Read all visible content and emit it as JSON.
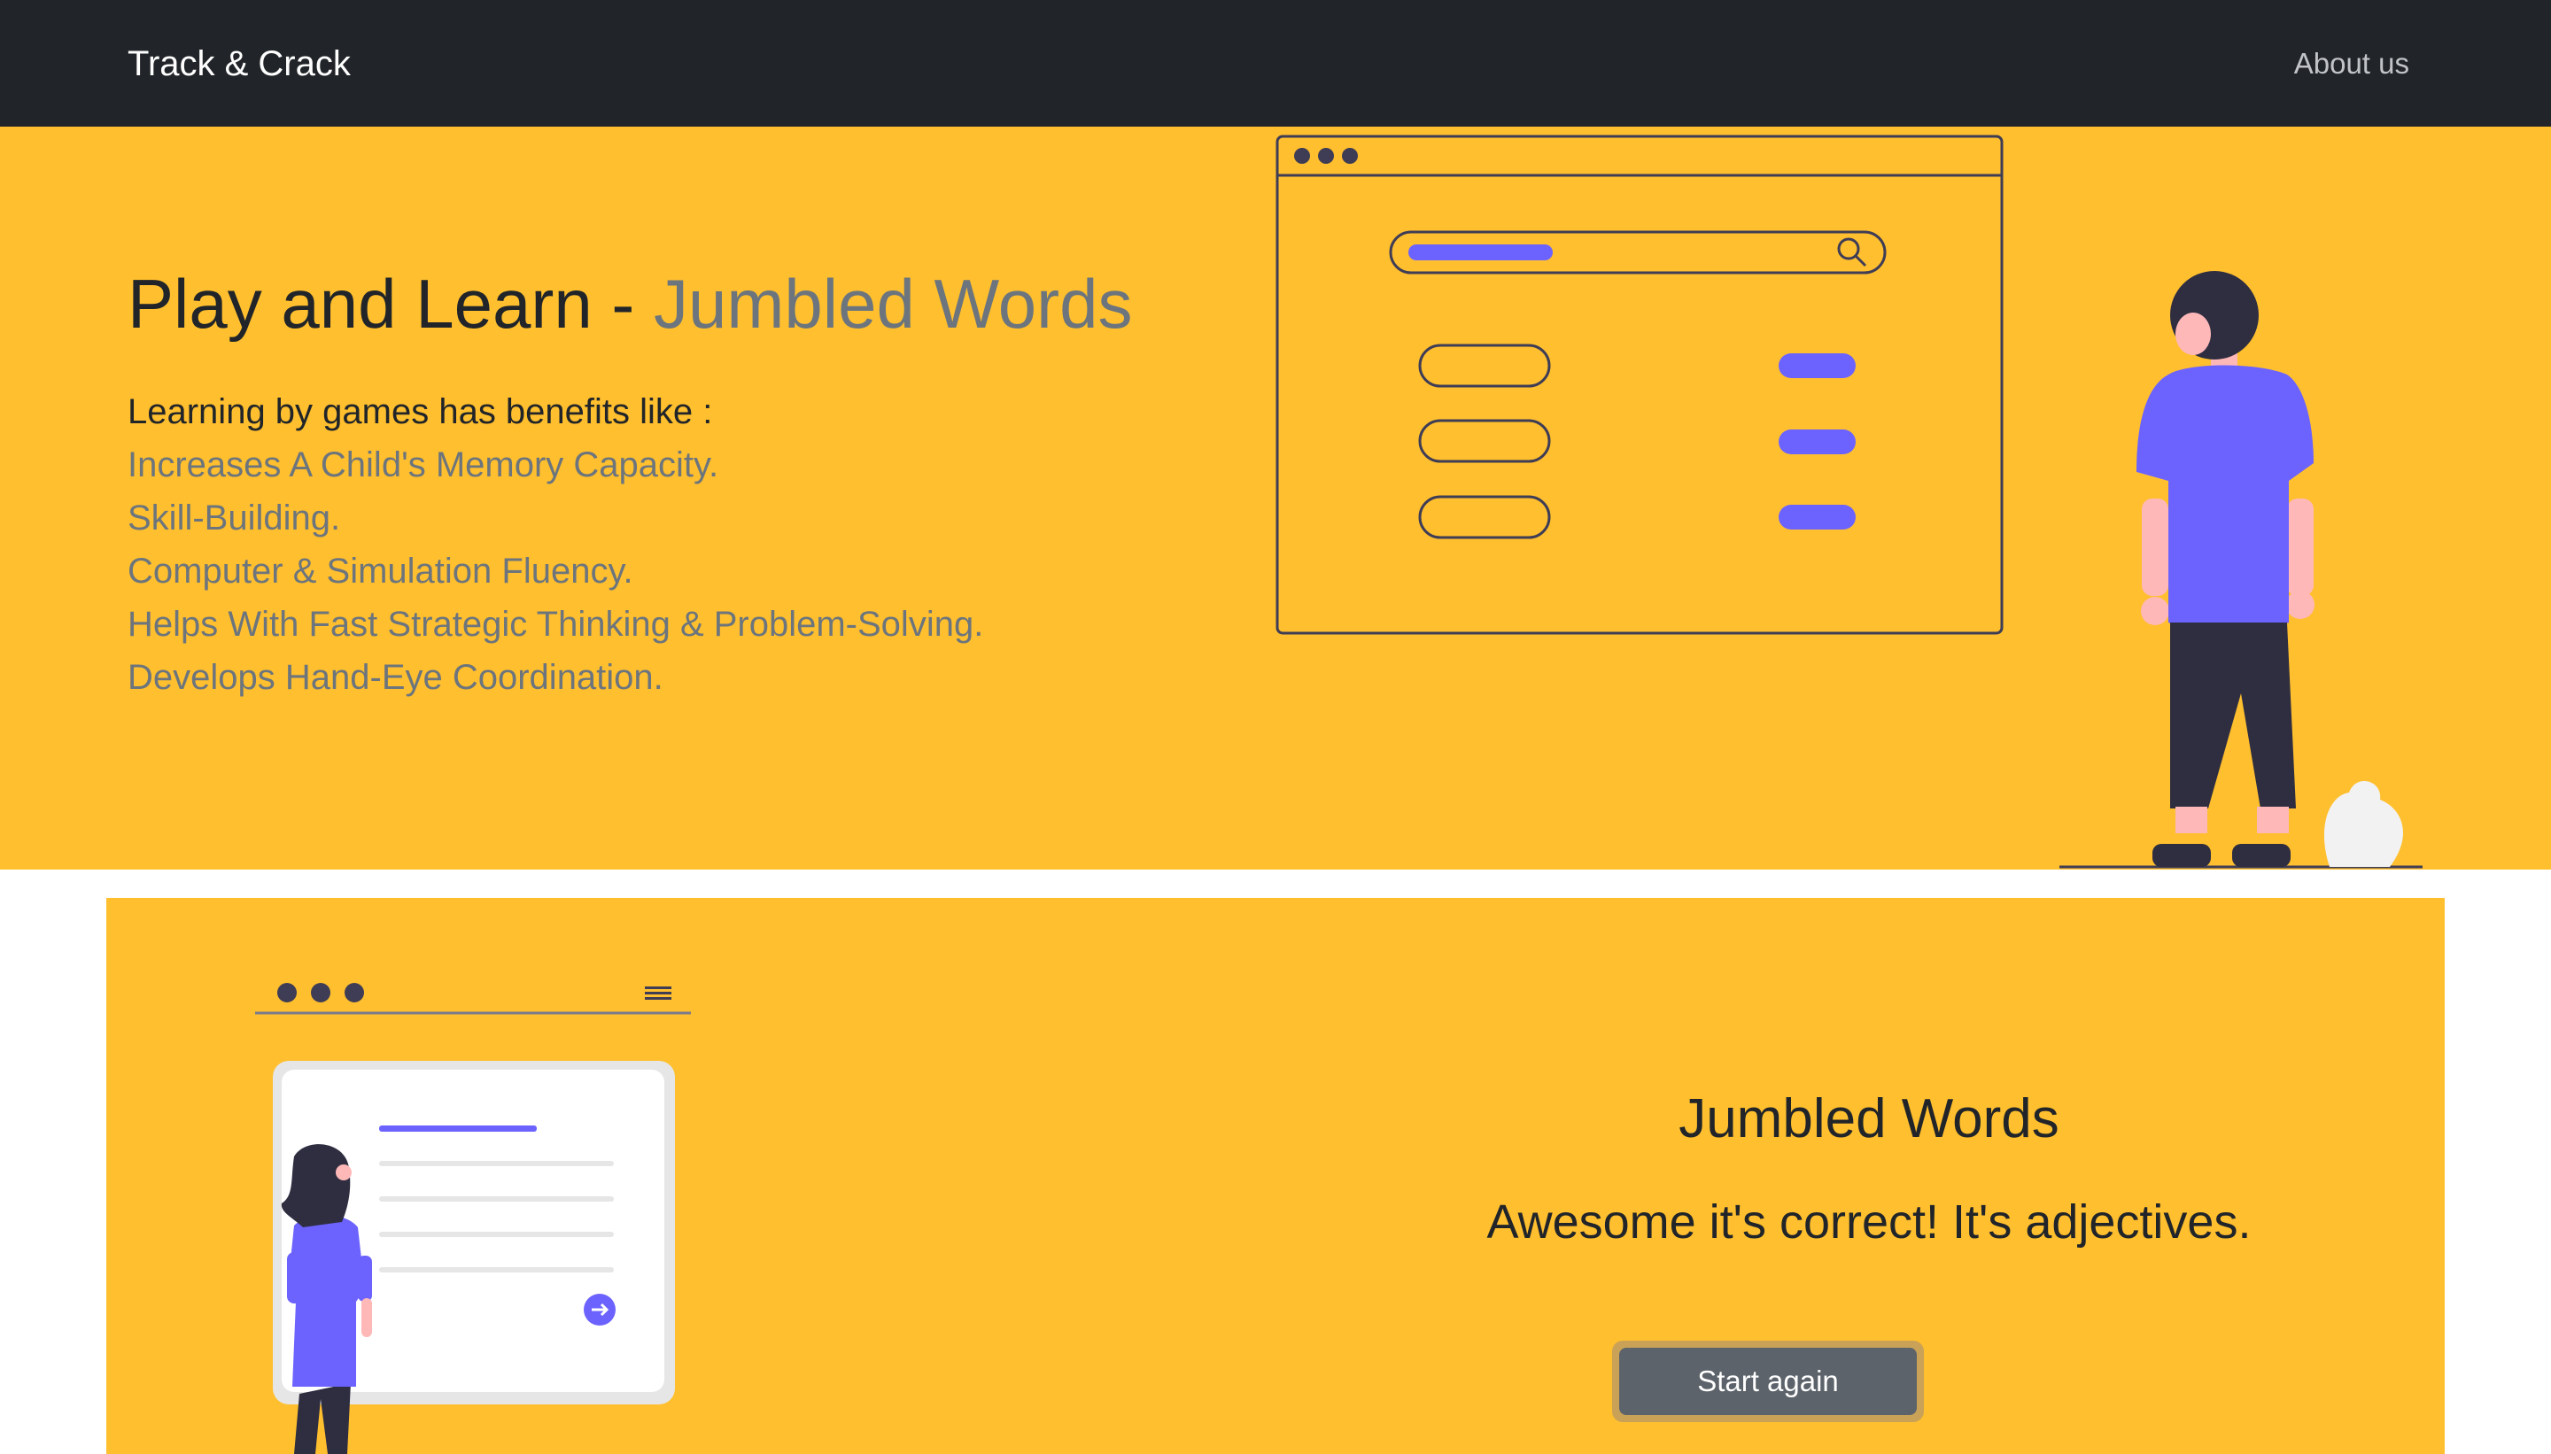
{
  "navbar": {
    "brand": "Track & Crack",
    "about_link": "About us"
  },
  "hero": {
    "title_main": "Play and Learn - ",
    "title_accent": "Jumbled Words",
    "intro": "Learning by games has benefits like :",
    "benefits": [
      "Increases A Child's Memory Capacity.",
      "Skill-Building.",
      "Computer & Simulation Fluency.",
      "Helps With Fast Strategic Thinking & Problem-Solving.",
      "Develops Hand-Eye Coordination."
    ]
  },
  "game": {
    "title": "Jumbled Words",
    "message": "Awesome it's correct! It's adjectives.",
    "button_label": "Start again"
  },
  "colors": {
    "navbar_bg": "#212529",
    "accent_yellow": "#ffbf2e",
    "muted_text": "#6c757d",
    "illustration_purple": "#6c63ff",
    "button_bg": "#5c636a"
  },
  "icons": [
    "search-icon",
    "window-dots-icon",
    "menu-icon",
    "arrow-right-circle-icon"
  ]
}
